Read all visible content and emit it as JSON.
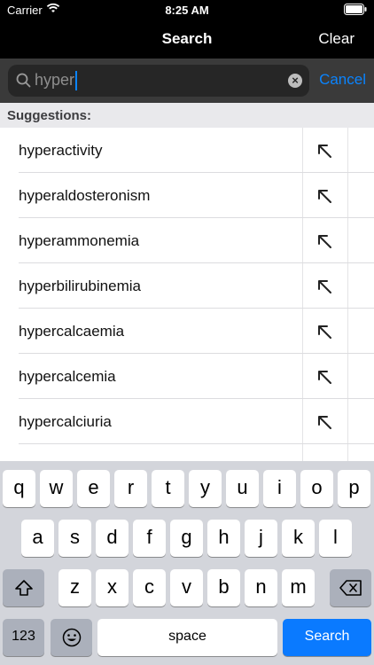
{
  "status_bar": {
    "carrier": "Carrier",
    "time": "8:25 AM"
  },
  "nav": {
    "title": "Search",
    "clear_label": "Clear"
  },
  "search": {
    "query": "hyper",
    "cancel_label": "Cancel"
  },
  "suggestions": {
    "header": "Suggestions:",
    "items": [
      {
        "label": "hyperactivity"
      },
      {
        "label": "hyperaldosteronism"
      },
      {
        "label": "hyperammonemia"
      },
      {
        "label": "hyperbilirubinemia"
      },
      {
        "label": "hypercalcaemia"
      },
      {
        "label": "hypercalcemia"
      },
      {
        "label": "hypercalciuria"
      },
      {
        "label": ""
      }
    ]
  },
  "keyboard": {
    "row1": [
      "q",
      "w",
      "e",
      "r",
      "t",
      "y",
      "u",
      "i",
      "o",
      "p"
    ],
    "row2": [
      "a",
      "s",
      "d",
      "f",
      "g",
      "h",
      "j",
      "k",
      "l"
    ],
    "row3": [
      "z",
      "x",
      "c",
      "v",
      "b",
      "n",
      "m"
    ],
    "numbers_label": "123",
    "space_label": "space",
    "search_label": "Search"
  },
  "colors": {
    "accent": "#0a84ff",
    "search_key": "#0a7aff"
  }
}
